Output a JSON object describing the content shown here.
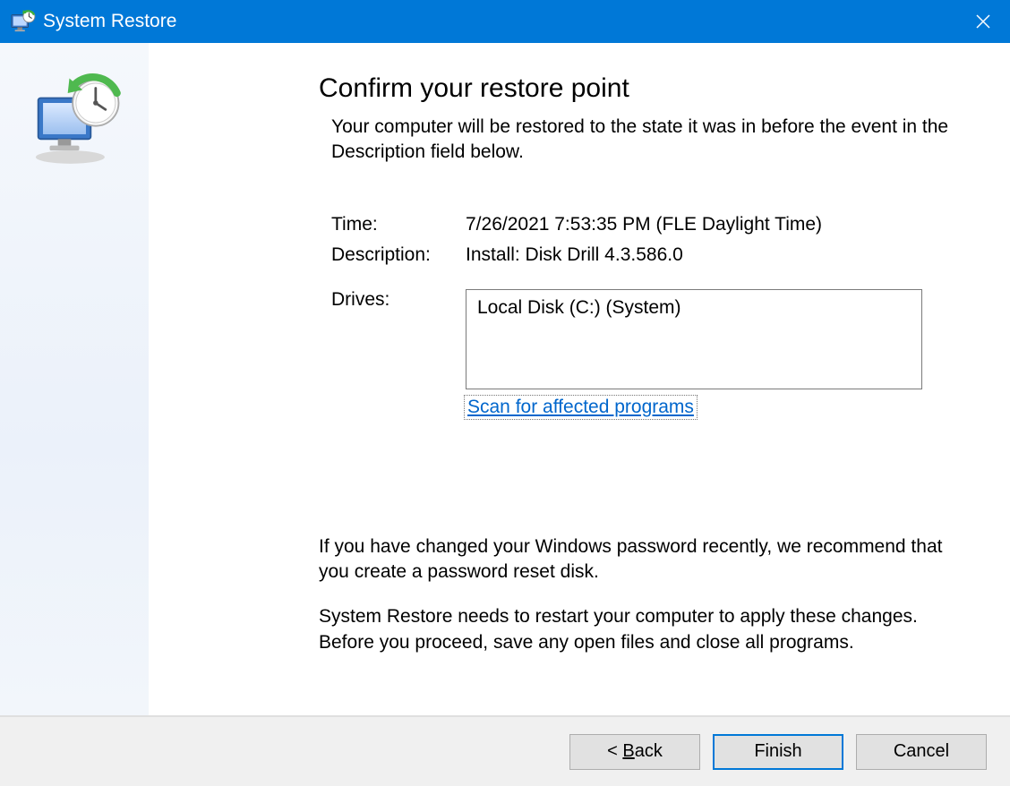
{
  "title": "System Restore",
  "heading": "Confirm your restore point",
  "subtitle": "Your computer will be restored to the state it was in before the event in the Description field below.",
  "labels": {
    "time": "Time:",
    "description": "Description:",
    "drives": "Drives:"
  },
  "values": {
    "time": "7/26/2021 7:53:35 PM (FLE Daylight Time)",
    "description": "Install: Disk Drill 4.3.586.0",
    "drives": "Local Disk (C:) (System)"
  },
  "link_scan": "Scan for affected programs",
  "note_password": "If you have changed your Windows password recently, we recommend that you create a password reset disk.",
  "note_restart": "System Restore needs to restart your computer to apply these changes. Before you proceed, save any open files and close all programs.",
  "buttons": {
    "back_prefix": "< ",
    "back_u": "B",
    "back_suffix": "ack",
    "finish": "Finish",
    "cancel": "Cancel"
  }
}
